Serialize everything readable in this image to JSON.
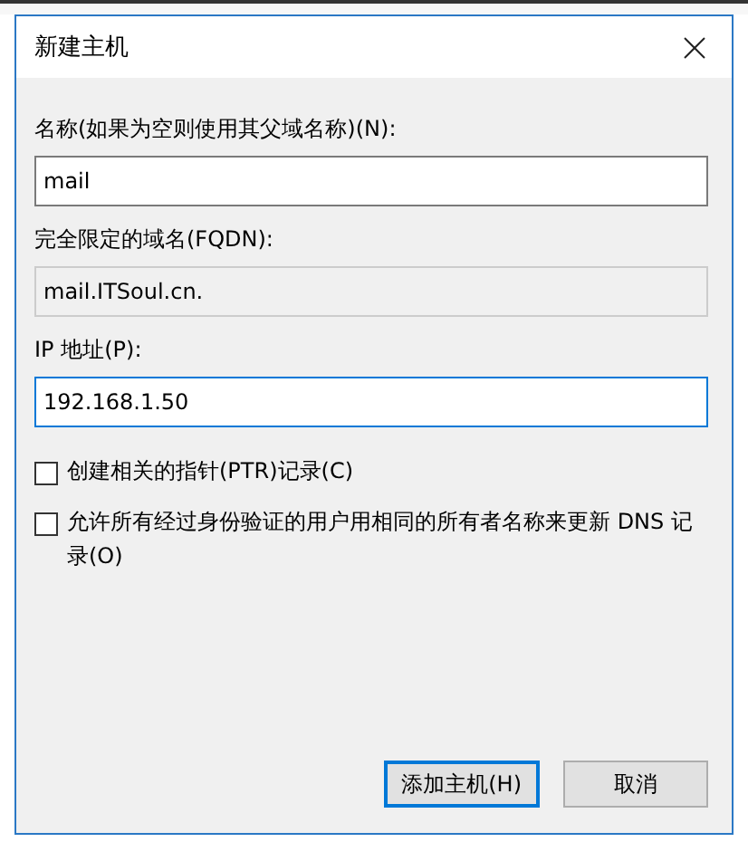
{
  "window": {
    "title": "新建主机"
  },
  "fields": [
    {
      "label": "名称(如果为空则使用其父域名称)(N):",
      "value": "mail",
      "readonly": false,
      "focused": false
    },
    {
      "label": "完全限定的域名(FQDN):",
      "value": "mail.ITSoul.cn.",
      "readonly": true,
      "focused": false
    },
    {
      "label": "IP 地址(P):",
      "value": "192.168.1.50",
      "readonly": false,
      "focused": true
    }
  ],
  "checkboxes": [
    {
      "label": "创建相关的指针(PTR)记录(C)",
      "checked": false
    },
    {
      "label": "允许所有经过身份验证的用户用相同的所有者名称来更新 DNS 记录(O)",
      "checked": false
    }
  ],
  "buttons": [
    {
      "label": "添加主机(H)",
      "default": true
    },
    {
      "label": "取消",
      "default": false
    }
  ]
}
